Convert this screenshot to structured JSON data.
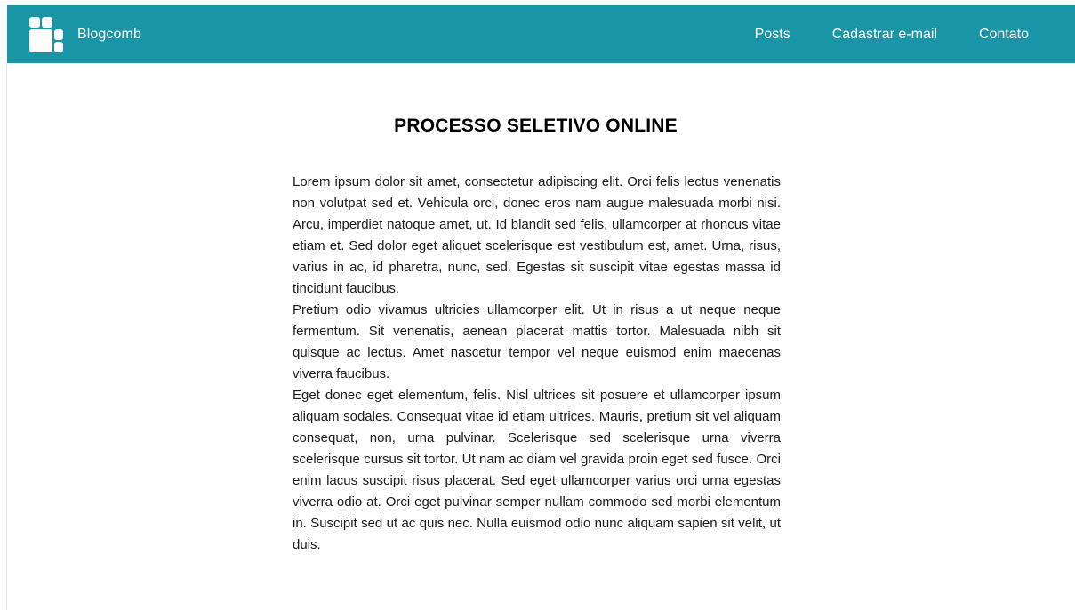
{
  "colors": {
    "accent": "#1895a6",
    "text": "#1a1a1a"
  },
  "navbar": {
    "logo_icon": "blocks-logo-icon",
    "brand": "Blogcomb",
    "links": [
      {
        "label": "Posts"
      },
      {
        "label": "Cadastrar e-mail"
      },
      {
        "label": "Contato"
      }
    ]
  },
  "main": {
    "title": "PROCESSO SELETIVO ONLINE",
    "paragraphs": [
      "Lorem ipsum dolor sit amet, consectetur adipiscing elit. Orci felis lectus venenatis non volutpat sed et. Vehicula orci, donec eros nam augue malesuada morbi nisi. Arcu, imperdiet natoque amet, ut. Id blandit sed felis, ullamcorper at rhoncus vitae etiam et. Sed dolor eget aliquet scelerisque est vestibulum est, amet. Urna, risus, varius in ac, id pharetra, nunc, sed. Egestas sit suscipit vitae egestas massa id tincidunt faucibus.",
      "Pretium odio vivamus ultricies ullamcorper elit. Ut in risus a ut neque neque fermentum. Sit venenatis, aenean placerat mattis tortor. Malesuada nibh sit quisque ac lectus. Amet nascetur tempor vel neque euismod enim maecenas viverra faucibus.",
      "Eget donec eget elementum, felis. Nisl ultrices sit posuere et ullamcorper ipsum aliquam sodales. Consequat vitae id etiam ultrices. Mauris, pretium sit vel aliquam consequat, non, urna pulvinar. Scelerisque sed scelerisque urna viverra scelerisque cursus sit tortor. Ut nam ac diam vel gravida proin eget sed fusce. Orci enim lacus suscipit risus placerat. Sed eget ullamcorper varius orci urna egestas viverra odio at. Orci eget pulvinar semper nullam commodo sed morbi elementum in. Suscipit sed ut ac quis nec. Nulla euismod odio nunc aliquam sapien sit velit, ut duis."
    ]
  }
}
